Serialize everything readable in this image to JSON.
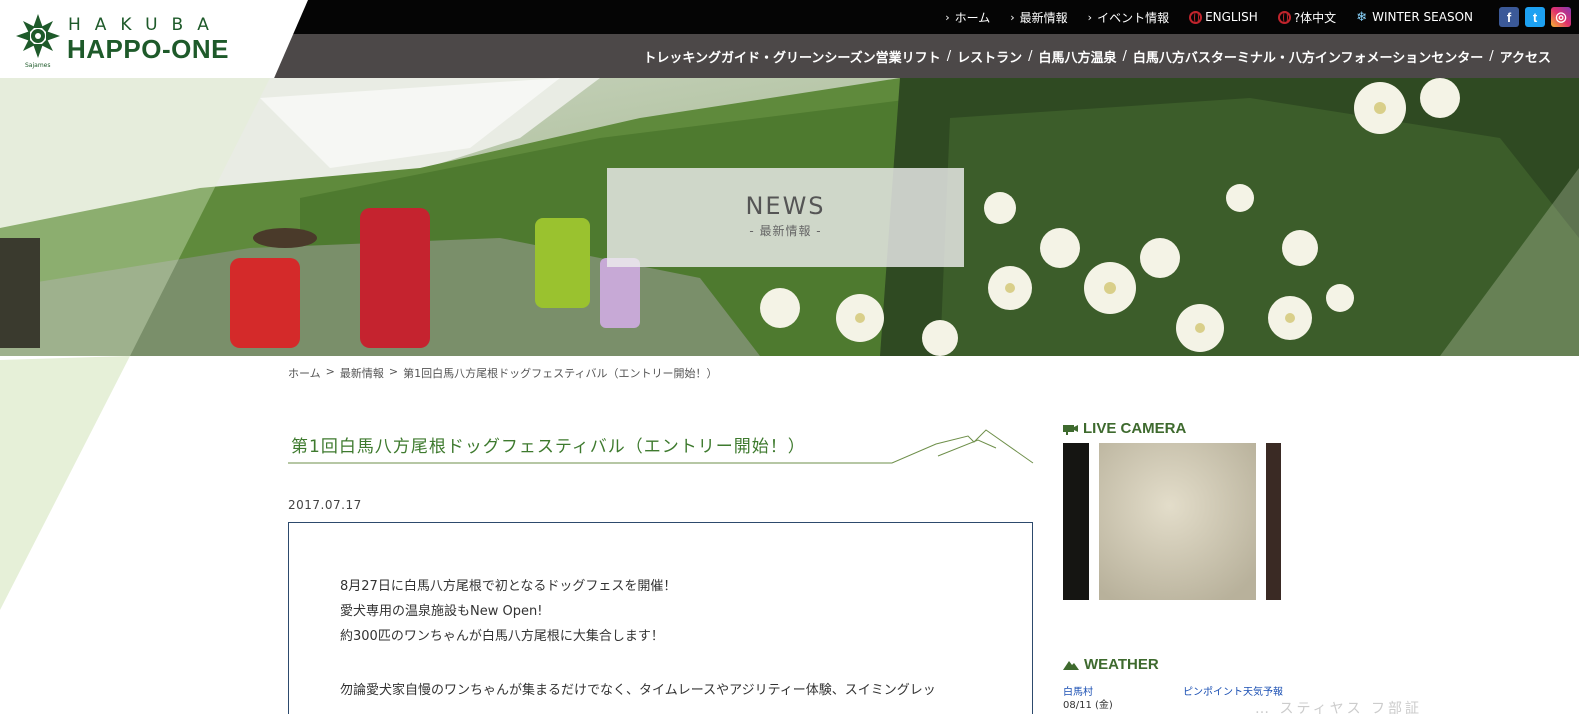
{
  "brand": {
    "sub": "HAKUBA",
    "name": "HAPPO-ONE",
    "tiny": "Sajames"
  },
  "top_links": [
    {
      "label": "ホーム",
      "icon": "chevron-right-icon"
    },
    {
      "label": "最新情報",
      "icon": "chevron-right-icon"
    },
    {
      "label": "イベント情報",
      "icon": "chevron-right-icon"
    },
    {
      "label": "ENGLISH",
      "icon": "globe-icon"
    },
    {
      "label": "?体中文",
      "icon": "globe-icon"
    },
    {
      "label": "WINTER SEASON",
      "icon": "snowflake-icon"
    }
  ],
  "social": [
    "facebook-icon",
    "twitter-icon",
    "instagram-icon"
  ],
  "main_nav": [
    "トレッキングガイド・グリーンシーズン営業リフト",
    "レストラン",
    "白馬八方温泉",
    "白馬八方バスターミナル・八方インフォメーションセンター",
    "アクセス"
  ],
  "nav_separator": "/",
  "hero": {
    "title": "NEWS",
    "subtitle": "- 最新情報 -"
  },
  "breadcrumb": {
    "items": [
      "ホーム",
      "最新情報",
      "第1回白馬八方尾根ドッグフェスティバル（エントリー開始！）"
    ],
    "separator": ">"
  },
  "article": {
    "title": "第1回白馬八方尾根ドッグフェスティバル（エントリー開始！）",
    "date": "2017.07.17",
    "paragraphs": [
      "8月27日に白馬八方尾根で初となるドッグフェスを開催！",
      "愛犬専用の温泉施設もNew Open!",
      "約300匹のワンちゃんが白馬八方尾根に大集合します！",
      "勿論愛犬家自慢のワンちゃんが集まるだけでなく、タイムレースやアジリティー体験、スイミングレッ"
    ]
  },
  "sidebar": {
    "live_camera": "LIVE CAMERA",
    "weather": "WEATHER",
    "weather_location": "白馬村",
    "weather_link": "ピンポイント天気予報",
    "weather_date": "08/11 (金)",
    "ghost_text": "… スティヤス フ部証"
  },
  "colors": {
    "topbar": "#050505",
    "navbar": "#4c4848",
    "brand_green": "#1e5a2a",
    "title_green": "#3e7a2e",
    "box_border": "#2d4a6d"
  }
}
